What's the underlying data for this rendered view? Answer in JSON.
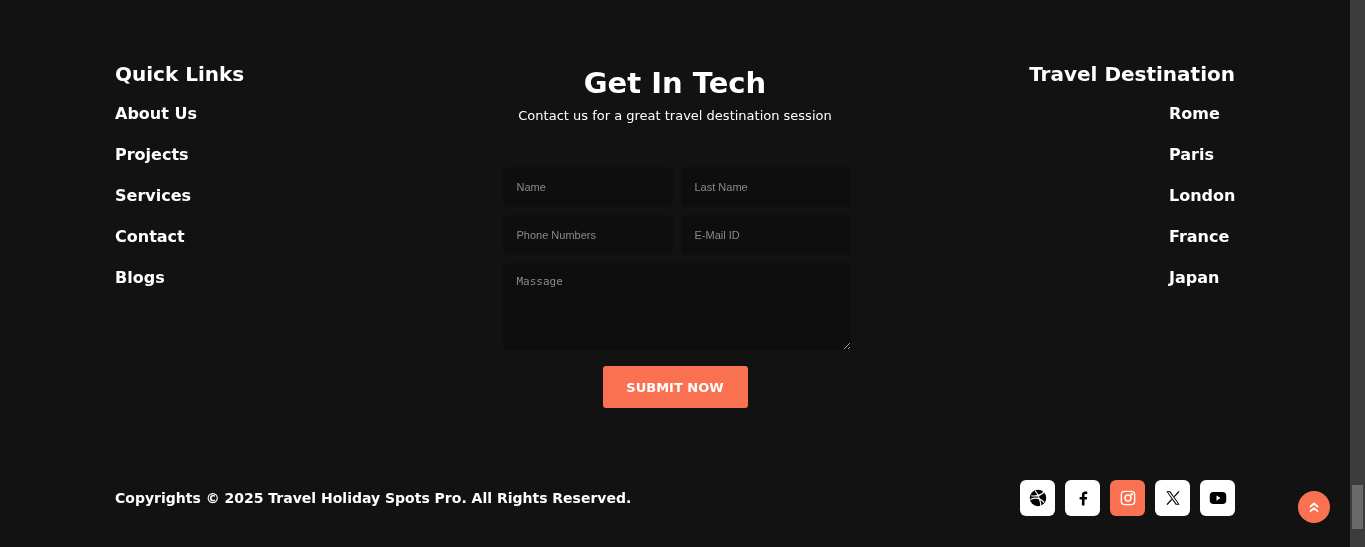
{
  "quick_links": {
    "title": "Quick Links",
    "items": [
      "About Us",
      "Projects",
      "Services",
      "Contact",
      "Blogs"
    ]
  },
  "contact": {
    "title": "Get In Tech",
    "subtitle": "Contact us for a great travel destination session",
    "fields": [
      {
        "placeholder": "Name",
        "kind": "input"
      },
      {
        "placeholder": "Last Name",
        "kind": "input"
      },
      {
        "placeholder": "Phone Numbers",
        "kind": "input"
      },
      {
        "placeholder": "E-Mail ID",
        "kind": "input"
      },
      {
        "placeholder": "Massage",
        "kind": "textarea"
      }
    ],
    "submit": "SUBMIT NOW"
  },
  "destinations": {
    "title": "Travel Destination",
    "items": [
      "Rome",
      "Paris",
      "London",
      "France",
      "Japan"
    ]
  },
  "copyright": "Copyrights © 2025 Travel Holiday Spots Pro. All Rights Reserved.",
  "social": [
    {
      "kind": "dribbble",
      "highlighted": false
    },
    {
      "kind": "facebook",
      "highlighted": false
    },
    {
      "kind": "instagram",
      "highlighted": true
    },
    {
      "kind": "x",
      "highlighted": false
    },
    {
      "kind": "youtube",
      "highlighted": false
    }
  ]
}
